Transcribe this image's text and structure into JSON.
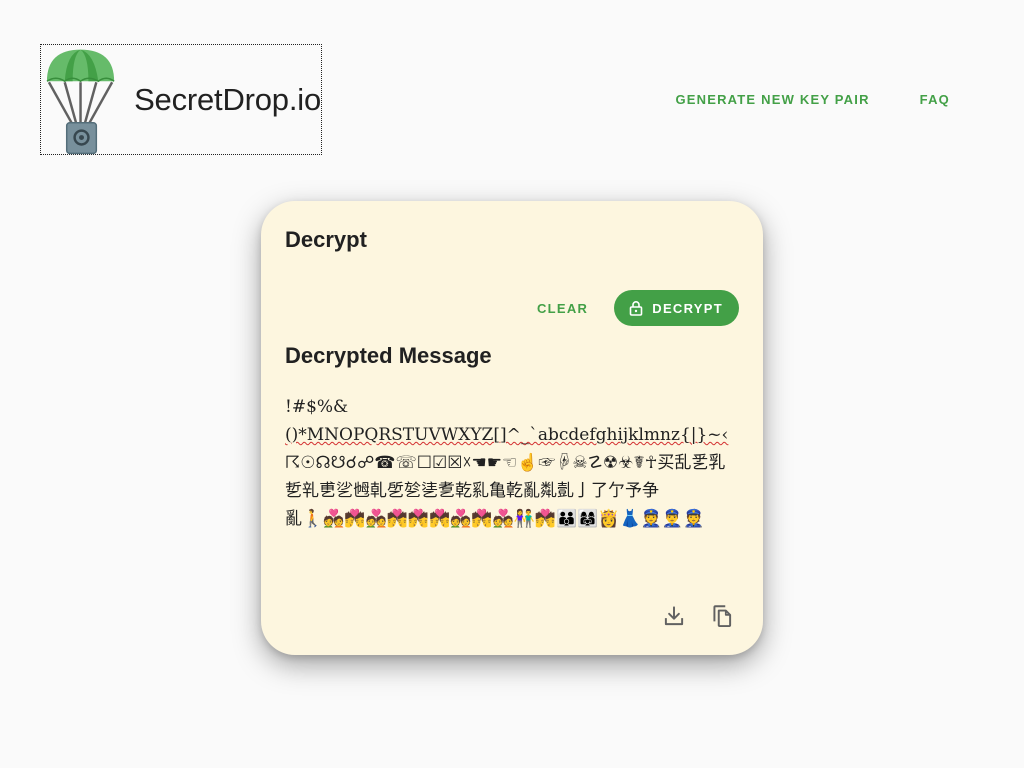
{
  "brand": {
    "name": "SecretDrop.io",
    "logo_icon": "parachute-safe-icon"
  },
  "nav": {
    "generate_label": "GENERATE NEW KEY PAIR",
    "faq_label": "FAQ"
  },
  "card": {
    "title": "Decrypt",
    "clear_label": "CLEAR",
    "decrypt_label": "DECRYPT",
    "decrypt_icon": "lock-icon",
    "section_title": "Decrypted Message",
    "message_lines": [
      "!#$%&",
      "()*MNOPQRSTUVWXYZ[]^_`abcdefghijklmnz{|}~‹",
      "☈☉☊☋☌☍☎☏☐☑☒☓☚☛☜☝☞☟☠☡☢☣☤☥买乱乯乳",
      "乴乵乶乷乸乹乺乻乼乽乾乿亀亁亂亃亄亅了亇予争",
      "亂🚶💑💏💑💏💏💏💑💏💑👫💏👪👩‍👩‍👧👸👗👮👮‍♂️👮"
    ],
    "footer": {
      "download_icon": "download-icon",
      "copy_icon": "copy-icon"
    }
  },
  "colors": {
    "accent": "#43a047",
    "card_bg": "#fdf6df",
    "page_bg": "#fafafa"
  }
}
